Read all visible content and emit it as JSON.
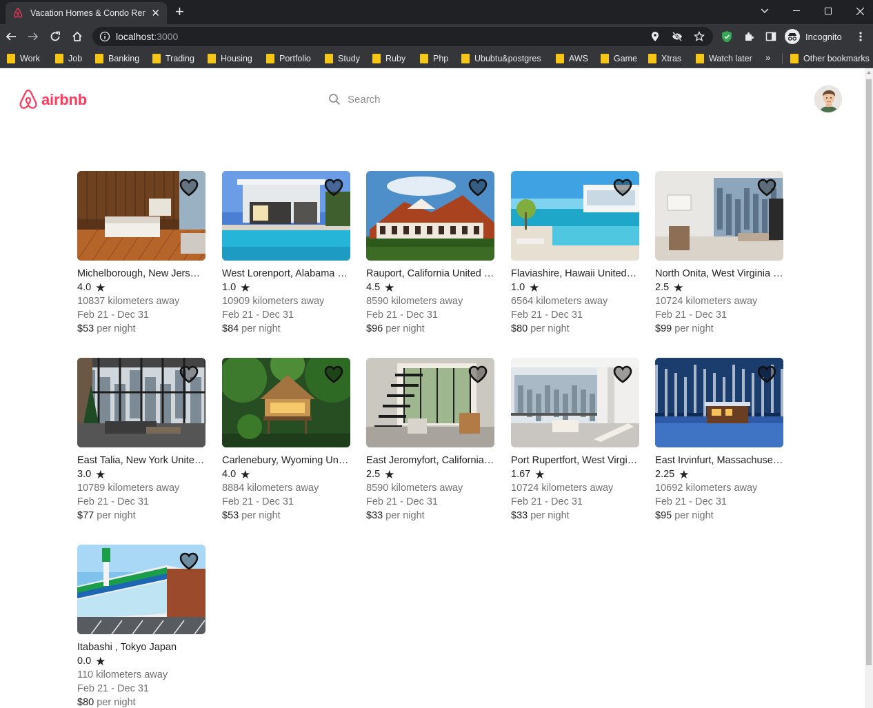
{
  "browser": {
    "tab_title": "Vacation Homes & Condo Rentals - Airbnb",
    "url_host": "localhost",
    "url_port": ":3000",
    "profile_label": "Incognito",
    "bookmarks": [
      "Work",
      "Job",
      "Banking",
      "Trading",
      "Housing",
      "Portfolio",
      "Study",
      "Ruby",
      "Php",
      "Ububtu&postgres",
      "AWS",
      "Game",
      "Xtras",
      "Watch later"
    ],
    "bookmarks_more": "»",
    "other_bookmarks": "Other bookmarks"
  },
  "header": {
    "logo_text": "airbnb",
    "search_placeholder": "Search",
    "brand_color": "#ff385c"
  },
  "listings": [
    {
      "title": "Michelborough, New Jersey United States",
      "rating": "4.0",
      "distance": "10837 kilometers away",
      "dates": "Feb 21 - Dec 31",
      "price": "$53",
      "price_suffix": "per night",
      "image": "bedroom"
    },
    {
      "title": "West Lorenport, Alabama United States",
      "rating": "1.0",
      "distance": "10909 kilometers away",
      "dates": "Feb 21 - Dec 31",
      "price": "$84",
      "price_suffix": "per night",
      "image": "modern-pool-house"
    },
    {
      "title": "Rauport, California United States",
      "rating": "4.5",
      "distance": "8590 kilometers away",
      "dates": "Feb 21 - Dec 31",
      "price": "$96",
      "price_suffix": "per night",
      "image": "tudor-house"
    },
    {
      "title": "Flaviashire, Hawaii United States",
      "rating": "1.0",
      "distance": "6564 kilometers away",
      "dates": "Feb 21 - Dec 31",
      "price": "$80",
      "price_suffix": "per night",
      "image": "beach-villa"
    },
    {
      "title": "North Onita, West Virginia United States",
      "rating": "2.5",
      "distance": "10724 kilometers away",
      "dates": "Feb 21 - Dec 31",
      "price": "$99",
      "price_suffix": "per night",
      "image": "apartment"
    },
    {
      "title": "East Talia, New York United States",
      "rating": "3.0",
      "distance": "10789 kilometers away",
      "dates": "Feb 21 - Dec 31",
      "price": "$77",
      "price_suffix": "per night",
      "image": "loft"
    },
    {
      "title": "Carlenebury, Wyoming United States",
      "rating": "4.0",
      "distance": "8884 kilometers away",
      "dates": "Feb 21 - Dec 31",
      "price": "$53",
      "price_suffix": "per night",
      "image": "jungle-hut"
    },
    {
      "title": "East Jeromyfort, California United States",
      "rating": "2.5",
      "distance": "8590 kilometers away",
      "dates": "Feb 21 - Dec 31",
      "price": "$33",
      "price_suffix": "per night",
      "image": "interior"
    },
    {
      "title": "Port Rupertfort, West Virginia United States",
      "rating": "1.67",
      "distance": "10724 kilometers away",
      "dates": "Feb 21 - Dec 31",
      "price": "$33",
      "price_suffix": "per night",
      "image": "balcony"
    },
    {
      "title": "East Irvinfurt, Massachusetts United States",
      "rating": "2.25",
      "distance": "10692 kilometers away",
      "dates": "Feb 21 - Dec 31",
      "price": "$95",
      "price_suffix": "per night",
      "image": "snow-cabin"
    },
    {
      "title": "Itabashi , Tokyo Japan",
      "rating": "0.0",
      "distance": "110 kilometers away",
      "dates": "Feb 21 - Dec 31",
      "price": "$80",
      "price_suffix": "per night",
      "image": "convenience-store"
    }
  ]
}
